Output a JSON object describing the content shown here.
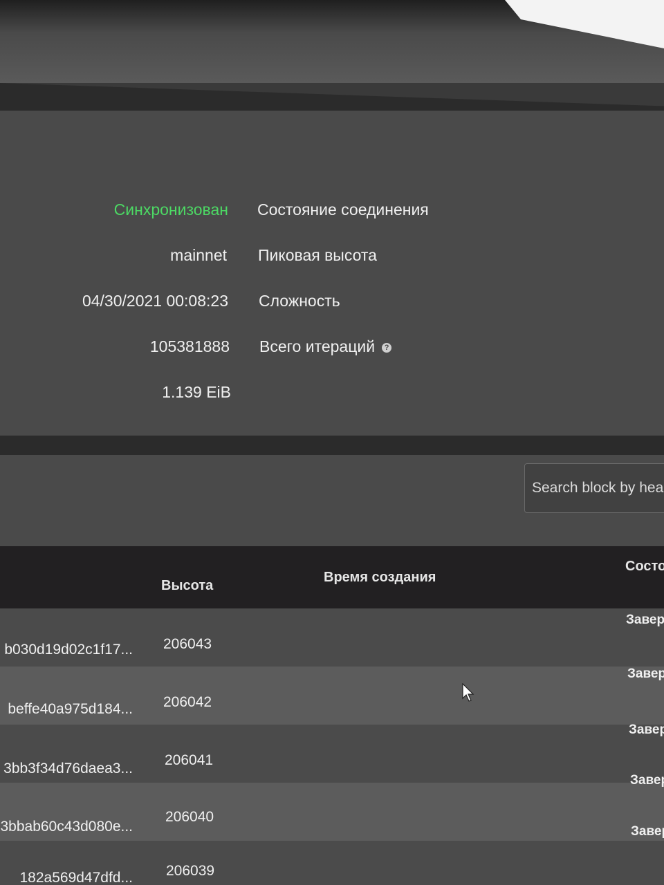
{
  "node_info": {
    "rows": [
      {
        "value": "Синхронизован",
        "label": "Состояние соединения"
      },
      {
        "value": "mainnet",
        "label": "Пиковая высота"
      },
      {
        "value": "04/30/2021 00:08:23",
        "label": "Сложность"
      },
      {
        "value": "105381888",
        "label": "Всего итераций"
      },
      {
        "value": "1.139 EiB",
        "label": ""
      }
    ],
    "status_color": "#4cd964"
  },
  "search": {
    "placeholder": "Search block by head"
  },
  "table": {
    "headers": {
      "height": "Высота",
      "created": "Время создания",
      "status": "Состоя"
    },
    "rows": [
      {
        "hash": "b030d19d02c1f17...",
        "height": "206043",
        "status": "Заверш"
      },
      {
        "hash": "beffe40a975d184...",
        "height": "206042",
        "status": "Заверш"
      },
      {
        "hash": "3bb3f34d76daea3...",
        "height": "206041",
        "status": "Завер"
      },
      {
        "hash": "3bbab60c43d080e...",
        "height": "206040",
        "status": "Завер"
      },
      {
        "hash": "182a569d47dfd...",
        "height": "206039",
        "status": "Завер"
      }
    ]
  }
}
